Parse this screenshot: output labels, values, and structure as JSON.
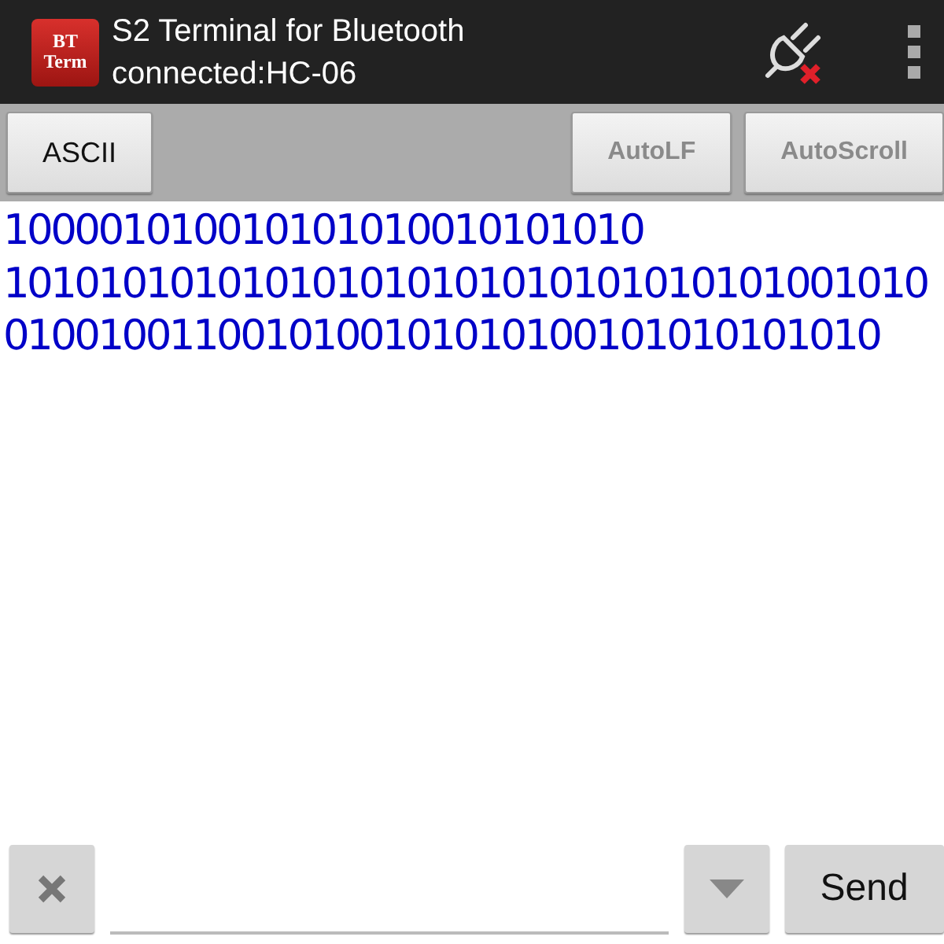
{
  "app_bar": {
    "title": "S2 Terminal for Bluetooth",
    "subtitle": "connected:HC-06",
    "logo_lines": [
      "BT",
      "Term"
    ]
  },
  "toolbar": {
    "buttons": [
      {
        "label": "ASCII",
        "disabled": false
      },
      {
        "label": "AutoLF",
        "disabled": true
      },
      {
        "label": "AutoScroll",
        "disabled": true
      }
    ]
  },
  "terminal": {
    "lines": [
      "100001010010101010010101010",
      "101010101010101010101010101010101001010",
      "0100100110010100101010100101010101010"
    ]
  },
  "input_bar": {
    "send_label": "Send"
  }
}
